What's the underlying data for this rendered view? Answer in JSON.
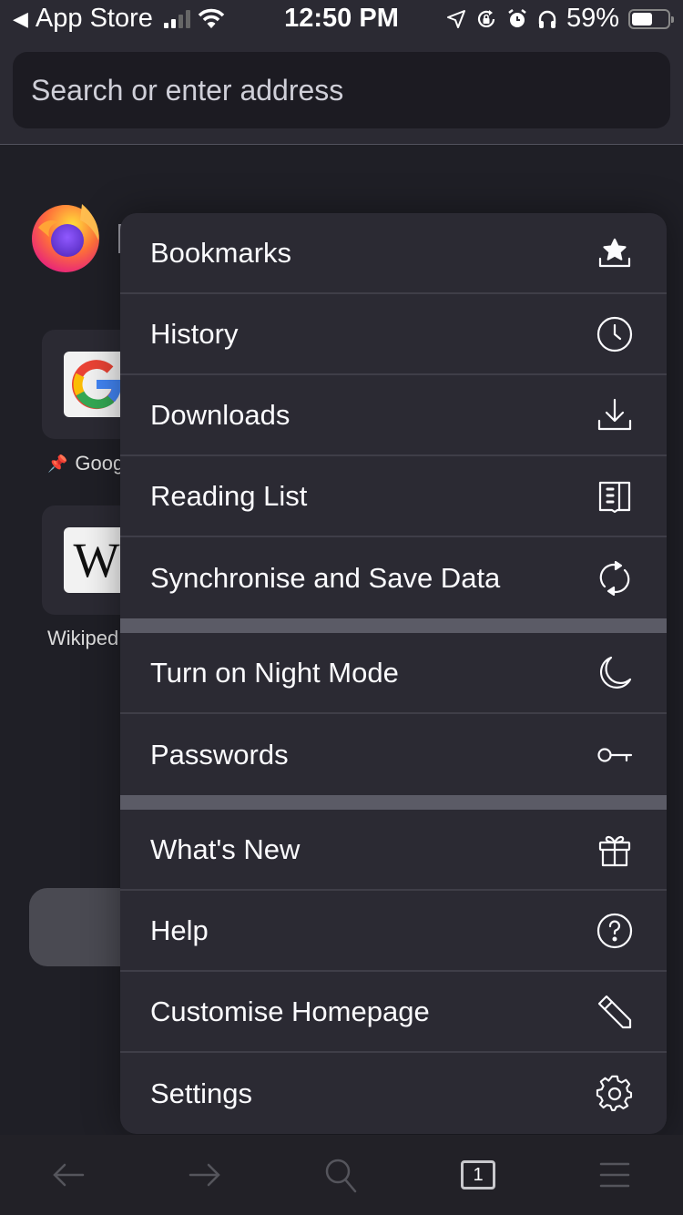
{
  "status_bar": {
    "back_app": "App Store",
    "time": "12:50 PM",
    "battery_percent": "59%",
    "battery_level": 0.59,
    "signal_bars_active": 2,
    "signal_bars_total": 4,
    "icons": [
      "back-triangle-icon",
      "cellular-signal-icon",
      "wifi-icon",
      "location-icon",
      "rotation-lock-icon",
      "alarm-icon",
      "headphones-icon",
      "battery-icon"
    ]
  },
  "url_bar": {
    "placeholder": "Search or enter address"
  },
  "home": {
    "logo": "firefox-logo",
    "top_sites": [
      {
        "label": "Goog",
        "pinned": true,
        "icon": "google-logo"
      },
      {
        "label": "Wikiped",
        "pinned": false,
        "icon": "wikipedia-logo",
        "glyph": "W"
      }
    ]
  },
  "menu": {
    "groups": [
      [
        {
          "label": "Bookmarks",
          "icon": "bookmark-star-icon"
        },
        {
          "label": "History",
          "icon": "clock-icon"
        },
        {
          "label": "Downloads",
          "icon": "download-icon"
        },
        {
          "label": "Reading List",
          "icon": "reading-list-icon"
        },
        {
          "label": "Synchronise and Save Data",
          "icon": "sync-icon"
        }
      ],
      [
        {
          "label": "Turn on Night Mode",
          "icon": "moon-icon"
        },
        {
          "label": "Passwords",
          "icon": "key-icon"
        }
      ],
      [
        {
          "label": "What's New",
          "icon": "gift-icon"
        },
        {
          "label": "Help",
          "icon": "help-circle-icon"
        },
        {
          "label": "Customise Homepage",
          "icon": "pencil-icon"
        },
        {
          "label": "Settings",
          "icon": "gear-icon"
        }
      ]
    ]
  },
  "toolbar": {
    "items": [
      {
        "name": "back",
        "icon": "arrow-left-icon"
      },
      {
        "name": "forward",
        "icon": "arrow-right-icon"
      },
      {
        "name": "search",
        "icon": "search-icon"
      },
      {
        "name": "tabs",
        "icon": "tabs-icon",
        "count": "1"
      },
      {
        "name": "menu",
        "icon": "hamburger-menu-icon"
      }
    ]
  },
  "colors": {
    "menu_bg": "#2b2a33",
    "separator": "#5b5b66",
    "divider": "#3f3e48",
    "text": "#fbfbfe",
    "toolbar_icon": "#55555c"
  }
}
